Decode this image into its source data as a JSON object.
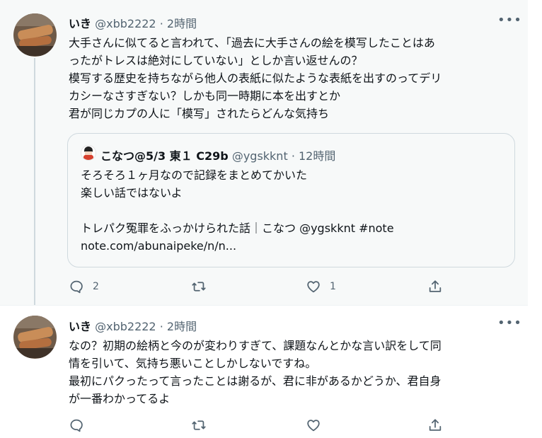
{
  "tweets": [
    {
      "name": "いき",
      "handle": "@xbb2222",
      "dot": "·",
      "time": "2時間",
      "more": "•••",
      "lines": [
        "大手さんに似てると言われて、「過去に大手さんの絵を模写したことはあ",
        "ったがトレスは絶対にしていない」としか言い返せんの？",
        "模写する歴史を持ちながら他人の表紙に似たような表紙を出すのってデリ",
        "カシーなさすぎない？しかも同一時期に本を出すとか",
        "君が同じカプの人に「模写」されたらどんな気持ち"
      ],
      "quote": {
        "name": "こなつ@5/3 東１ C29b",
        "handle": "@ygskknt",
        "dot": "·",
        "time": "12時間",
        "lines": [
          "そろそろ１ヶ月なので記録をまとめてかいた",
          "楽しい話ではないよ",
          "",
          "トレパク冤罪をふっかけられた話｜こなつ @ygskknt #note",
          "note.com/abunaipeke/n/n..."
        ]
      },
      "actions": {
        "reply_count": "2",
        "retweet_count": "",
        "like_count": "1"
      }
    },
    {
      "name": "いき",
      "handle": "@xbb2222",
      "dot": "·",
      "time": "2時間",
      "more": "•••",
      "lines": [
        "なの？初期の絵柄と今のが変わりすぎて、課題なんとかな言い訳をして同",
        "情を引いて、気持ち悪いことしかしないですね。",
        "最初にパクったって言ったことは謝るが、君に非があるかどうか、君自身",
        "が一番わかってるよ"
      ],
      "actions": {
        "reply_count": "",
        "retweet_count": "",
        "like_count": ""
      }
    }
  ],
  "icons": {
    "reply": "reply-icon",
    "retweet": "retweet-icon",
    "like": "heart-icon",
    "share": "share-icon"
  },
  "colors": {
    "icon_gray": "#536471",
    "text": "#0f1419",
    "border": "#cfd9de",
    "highlight_bg": "#f7f9f9"
  }
}
